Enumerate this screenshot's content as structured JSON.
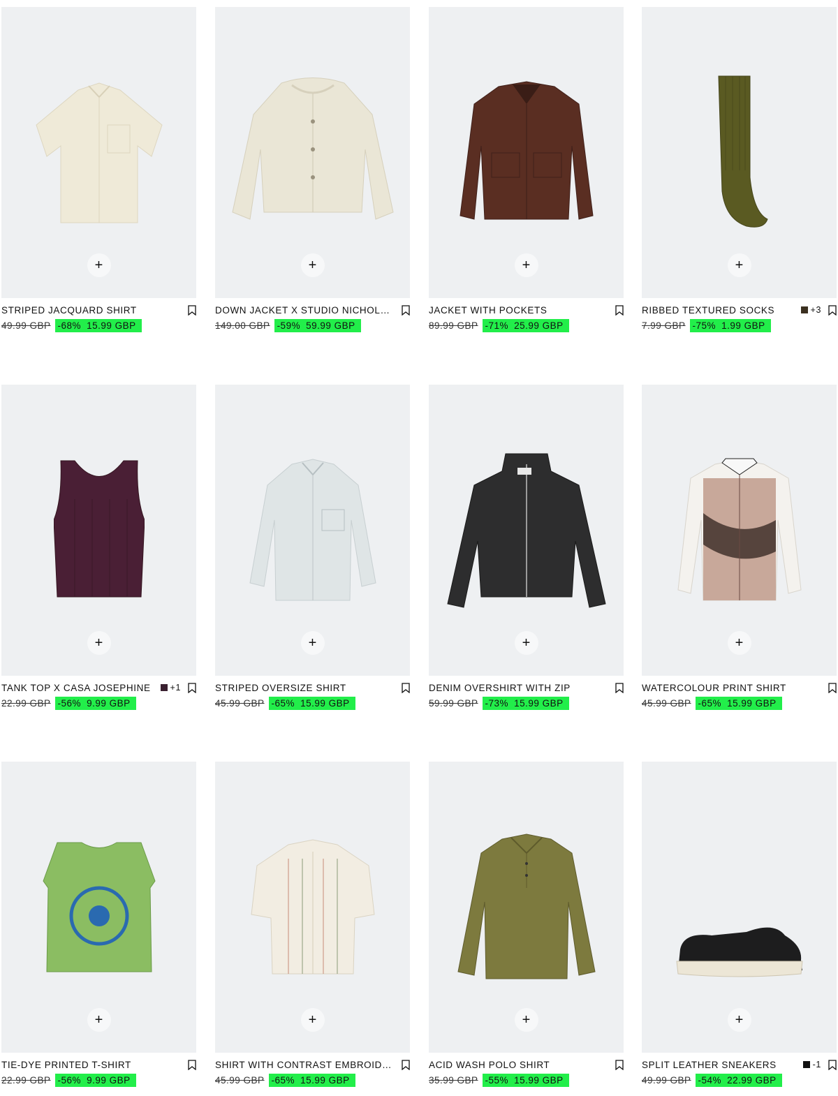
{
  "accent_color": "#22ee4a",
  "add_icon": "plus-icon",
  "bookmark_icon": "bookmark-icon",
  "products": [
    {
      "title": "STRIPED JACQUARD SHIRT",
      "old_price": "49.99 GBP",
      "discount": "-68%",
      "price": "15.99 GBP",
      "colour_extra": ""
    },
    {
      "title": "DOWN JACKET X STUDIO NICHOLSON",
      "old_price": "149.00 GBP",
      "discount": "-59%",
      "price": "59.99 GBP",
      "colour_extra": ""
    },
    {
      "title": "JACKET WITH POCKETS",
      "old_price": "89.99 GBP",
      "discount": "-71%",
      "price": "25.99 GBP",
      "colour_extra": ""
    },
    {
      "title": "RIBBED TEXTURED SOCKS",
      "old_price": "7.99 GBP",
      "discount": "-75%",
      "price": "1.99 GBP",
      "colour_extra": "+3",
      "swatch_color": "#3b3020"
    },
    {
      "title": "TANK TOP X CASA JOSEPHINE",
      "old_price": "22.99 GBP",
      "discount": "-56%",
      "price": "9.99 GBP",
      "colour_extra": "+1",
      "swatch_color": "#3a2030"
    },
    {
      "title": "STRIPED OVERSIZE SHIRT",
      "old_price": "45.99 GBP",
      "discount": "-65%",
      "price": "15.99 GBP",
      "colour_extra": ""
    },
    {
      "title": "DENIM OVERSHIRT WITH ZIP",
      "old_price": "59.99 GBP",
      "discount": "-73%",
      "price": "15.99 GBP",
      "colour_extra": ""
    },
    {
      "title": "WATERCOLOUR PRINT SHIRT",
      "old_price": "45.99 GBP",
      "discount": "-65%",
      "price": "15.99 GBP",
      "colour_extra": ""
    },
    {
      "title": "TIE-DYE PRINTED T-SHIRT",
      "old_price": "22.99 GBP",
      "discount": "-56%",
      "price": "9.99 GBP",
      "colour_extra": ""
    },
    {
      "title": "SHIRT WITH CONTRAST EMBROIDERY",
      "old_price": "45.99 GBP",
      "discount": "-65%",
      "price": "15.99 GBP",
      "colour_extra": ""
    },
    {
      "title": "ACID WASH POLO SHIRT",
      "old_price": "35.99 GBP",
      "discount": "-55%",
      "price": "15.99 GBP",
      "colour_extra": ""
    },
    {
      "title": "SPLIT LEATHER SNEAKERS",
      "old_price": "49.99 GBP",
      "discount": "-54%",
      "price": "22.99 GBP",
      "colour_extra": "-1",
      "swatch_color": "#111111"
    }
  ]
}
